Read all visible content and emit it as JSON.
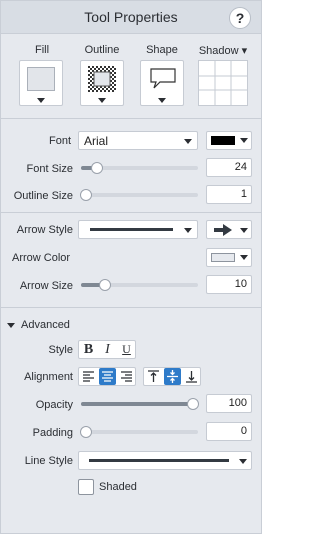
{
  "header": {
    "title": "Tool Properties",
    "help_label": "?"
  },
  "tabs": {
    "fill_label": "Fill",
    "outline_label": "Outline",
    "shape_label": "Shape",
    "shadow_label": "Shadow ▾"
  },
  "text_props": {
    "font_label": "Font",
    "font_value": "Arial",
    "font_color": "#000000",
    "font_size_label": "Font Size",
    "font_size_value": "24",
    "font_size_level": 0.12,
    "outline_size_label": "Outline Size",
    "outline_size_value": "1",
    "outline_size_level": 0.0
  },
  "arrow": {
    "style_label": "Arrow Style",
    "color_label": "Arrow Color",
    "color_value": "#e6e9ee",
    "size_label": "Arrow Size",
    "size_value": "10",
    "size_level": 0.16
  },
  "advanced": {
    "section_label": "Advanced",
    "style_label": "Style",
    "bold_label": "B",
    "italic_label": "I",
    "underline_label": "U",
    "alignment_label": "Alignment",
    "opacity_label": "Opacity",
    "opacity_value": "100",
    "opacity_level": 1.0,
    "padding_label": "Padding",
    "padding_value": "0",
    "padding_level": 0.0,
    "line_style_label": "Line Style",
    "shaded_label": "Shaded",
    "shaded_checked": false
  },
  "colors": {
    "accent": "#2e7bc9"
  }
}
